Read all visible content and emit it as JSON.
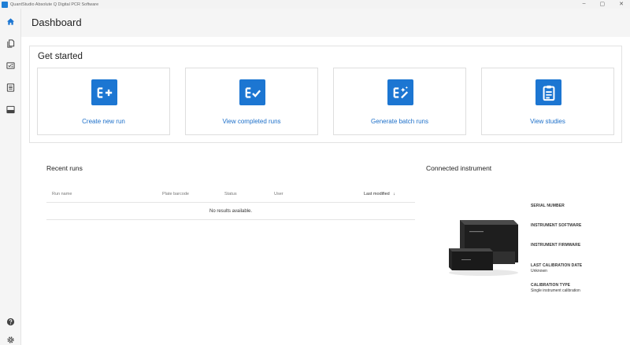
{
  "titlebar": {
    "title": "QuantStudio Absolute Q Digital PCR Software",
    "minimize": "–",
    "maximize": "▢",
    "close": "✕"
  },
  "sidebar": {
    "items": [
      {
        "icon": "home-icon",
        "active": true
      },
      {
        "icon": "documents-icon",
        "active": false
      },
      {
        "icon": "checklist-icon",
        "active": false
      },
      {
        "icon": "list-icon",
        "active": false
      },
      {
        "icon": "instrument-icon",
        "active": false
      }
    ],
    "bottom": [
      {
        "icon": "help-icon"
      },
      {
        "icon": "settings-icon"
      }
    ]
  },
  "header": {
    "title": "Dashboard"
  },
  "get_started": {
    "title": "Get started",
    "cards": [
      {
        "label": "Create new run",
        "icon": "create-run-icon"
      },
      {
        "label": "View completed runs",
        "icon": "completed-runs-icon"
      },
      {
        "label": "Generate batch runs",
        "icon": "batch-runs-icon"
      },
      {
        "label": "View studies",
        "icon": "studies-icon"
      }
    ]
  },
  "recent_runs": {
    "title": "Recent runs",
    "columns": [
      "Run name",
      "Plate barcode",
      "Status",
      "User",
      "Last modified"
    ],
    "sort_indicator": "↓",
    "empty_message": "No results available."
  },
  "connected_instrument": {
    "title": "Connected instrument",
    "fields": [
      {
        "label": "SERIAL NUMBER",
        "value": ""
      },
      {
        "label": "INSTRUMENT SOFTWARE",
        "value": ""
      },
      {
        "label": "INSTRUMENT FIRMWARE",
        "value": ""
      },
      {
        "label": "LAST CALIBRATION DATE",
        "value": "Unknown"
      },
      {
        "label": "CALIBRATION TYPE",
        "value": "Single instrument calibration"
      }
    ]
  },
  "colors": {
    "accent": "#1c76d2",
    "link": "#1c6fc9",
    "sidebar_bg": "#f5f5f5"
  }
}
